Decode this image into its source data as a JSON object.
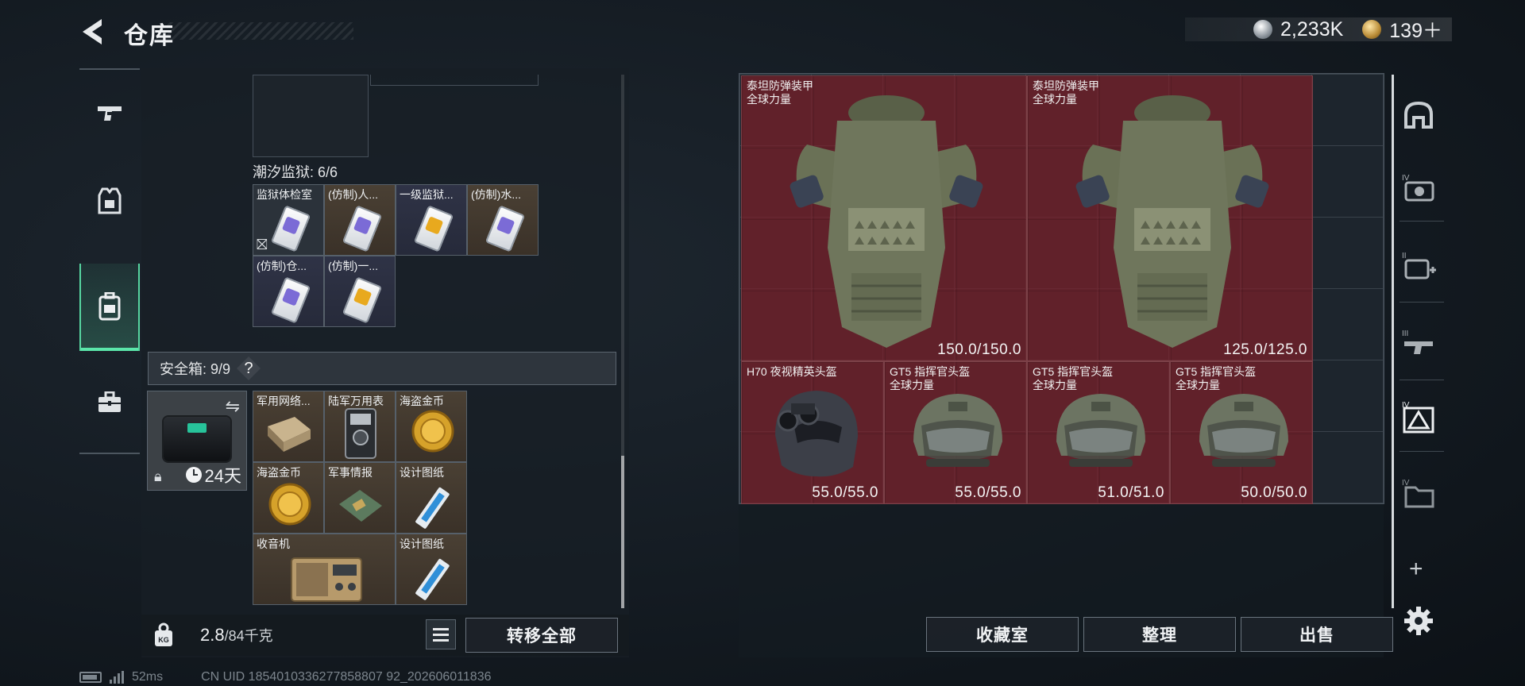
{
  "header": {
    "title": "仓库",
    "currency": [
      {
        "icon": "silver-coin-icon",
        "value": "2,233K"
      },
      {
        "icon": "gold-coin-icon",
        "value": "139＋"
      }
    ]
  },
  "left_nav": {
    "items": [
      {
        "icon": "gun-icon",
        "active": false
      },
      {
        "icon": "armor-vest-icon",
        "active": false
      },
      {
        "icon": "backpack-icon",
        "active": true
      },
      {
        "icon": "briefcase-icon",
        "active": false
      }
    ]
  },
  "inventory": {
    "prison_section": {
      "label": "潮汐监狱: 6/6",
      "slots": [
        "监狱体检室",
        "(仿制)人...",
        "一级监狱...",
        "(仿制)水...",
        "(仿制)仓...",
        "(仿制)一..."
      ]
    },
    "safebox": {
      "label": "安全箱: 9/9",
      "help": "?",
      "days": "24天",
      "items": [
        "军用网络...",
        "陆军万用表",
        "海盗金币",
        "海盗金币",
        "军事情报",
        "设计图纸",
        "收音机",
        "设计图纸"
      ]
    },
    "weight": {
      "current": "2.8",
      "max": "/84千克"
    },
    "transfer_all_label": "转移全部"
  },
  "equipment": {
    "items": [
      {
        "name_line1": "泰坦防弹装甲",
        "name_line2": "全球力量",
        "durability": "150.0/150.0"
      },
      {
        "name_line1": "泰坦防弹装甲",
        "name_line2": "全球力量",
        "durability": "125.0/125.0"
      },
      {
        "name_line1": "H70 夜视精英头盔",
        "name_line2": "",
        "durability": "55.0/55.0"
      },
      {
        "name_line1": "GT5 指挥官头盔",
        "name_line2": "全球力量",
        "durability": "55.0/55.0"
      },
      {
        "name_line1": "GT5 指挥官头盔",
        "name_line2": "全球力量",
        "durability": "51.0/51.0"
      },
      {
        "name_line1": "GT5 指挥官头盔",
        "name_line2": "全球力量",
        "durability": "50.0/50.0"
      }
    ],
    "buttons": {
      "collection": "收藏室",
      "sort": "整理",
      "sell": "出售"
    }
  },
  "right_strip": {
    "items": [
      "helmet-slot-icon",
      "level-iv-camera-icon",
      "level-ii-medkit-icon",
      "level-iii-gun-icon",
      "level-iv-armor-crate-icon",
      "level-iv-folder-icon"
    ],
    "plus": "+"
  },
  "status_bar": {
    "ping": "52ms",
    "uid": "CN UID 1854010336277858807 92_202606011836"
  },
  "colors": {
    "accent": "#5be6aa",
    "item_highlight": "#7c202a"
  }
}
